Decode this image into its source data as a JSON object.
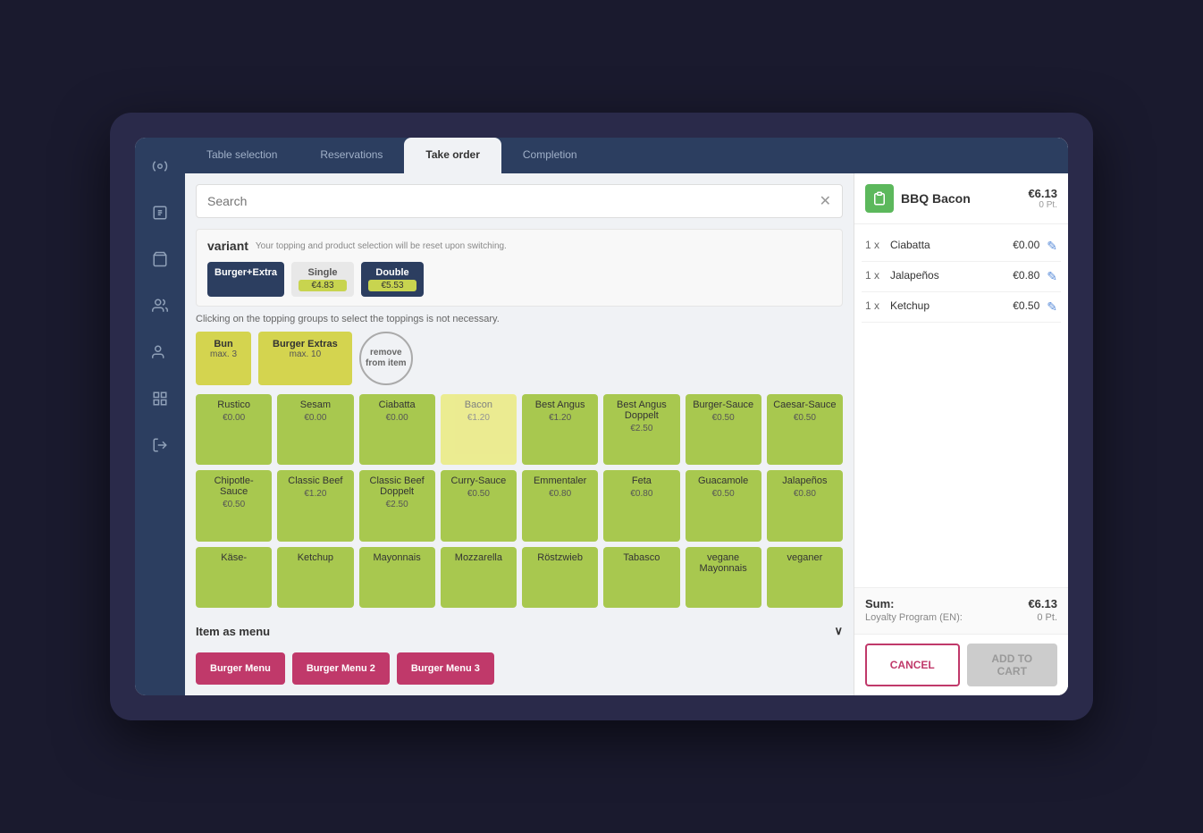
{
  "tabs": [
    {
      "label": "Table selection",
      "active": false
    },
    {
      "label": "Reservations",
      "active": false
    },
    {
      "label": "Take order",
      "active": true
    },
    {
      "label": "Completion",
      "active": false
    }
  ],
  "sidebar": {
    "icons": [
      "nav-icon-1",
      "nav-icon-2",
      "nav-icon-3",
      "nav-icon-4",
      "nav-icon-5",
      "nav-icon-6"
    ]
  },
  "search": {
    "placeholder": "Search"
  },
  "variant": {
    "label": "variant",
    "subtitle": "Your topping and product selection will be reset upon switching.",
    "options": [
      {
        "label": "Burger+Extra",
        "price": null,
        "style": "dark"
      },
      {
        "label": "Single",
        "price": "€4.83",
        "style": "light"
      },
      {
        "label": "Double",
        "price": "€5.53",
        "style": "dark"
      }
    ]
  },
  "topping_info": "Clicking on the topping groups to select the toppings is not necessary.",
  "topping_groups": [
    {
      "label": "Bun",
      "max": "max. 3"
    },
    {
      "label": "Burger Extras",
      "max": "max. 10"
    },
    {
      "label": "remove from item",
      "style": "circle"
    }
  ],
  "toppings": [
    {
      "name": "Rustico",
      "price": "€0.00"
    },
    {
      "name": "Sesam",
      "price": "€0.00"
    },
    {
      "name": "Ciabatta",
      "price": "€0.00",
      "selected": true
    },
    {
      "name": "Bacon",
      "price": "€1.20",
      "light": true
    },
    {
      "name": "Best Angus",
      "price": "€1.20"
    },
    {
      "name": "Best Angus Doppelt",
      "price": "€2.50"
    },
    {
      "name": "Burger-Sauce",
      "price": "€0.50"
    },
    {
      "name": "Caesar-Sauce",
      "price": "€0.50"
    },
    {
      "name": "Chipotle-Sauce",
      "price": "€0.50"
    },
    {
      "name": "Classic Beef",
      "price": "€1.20"
    },
    {
      "name": "Classic Beef Doppelt",
      "price": "€2.50"
    },
    {
      "name": "Curry-Sauce",
      "price": "€0.50"
    },
    {
      "name": "Emmentaler",
      "price": "€0.80"
    },
    {
      "name": "Feta",
      "price": "€0.80"
    },
    {
      "name": "Guacamole",
      "price": "€0.50"
    },
    {
      "name": "Jalapeños",
      "price": "€0.80",
      "selected": true
    },
    {
      "name": "Käse-",
      "price": ""
    },
    {
      "name": "Ketchup",
      "price": ""
    },
    {
      "name": "Mayonnais",
      "price": ""
    },
    {
      "name": "Mozzarella",
      "price": ""
    },
    {
      "name": "Röstzwieb",
      "price": ""
    },
    {
      "name": "Tabasco",
      "price": ""
    },
    {
      "name": "vegane Mayonnais",
      "price": ""
    },
    {
      "name": "veganer",
      "price": ""
    }
  ],
  "menu_section": {
    "label": "Item as menu",
    "buttons": [
      {
        "label": "Burger Menu"
      },
      {
        "label": "Burger Menu 2"
      },
      {
        "label": "Burger Menu 3"
      }
    ]
  },
  "order": {
    "title": "BBQ Bacon",
    "price": "€6.13",
    "pts": "0 Pt.",
    "items": [
      {
        "qty": "1 x",
        "name": "Ciabatta",
        "price": "€0.00"
      },
      {
        "qty": "1 x",
        "name": "Jalapeños",
        "price": "€0.80"
      },
      {
        "qty": "1 x",
        "name": "Ketchup",
        "price": "€0.50"
      }
    ],
    "sum_label": "Sum:",
    "sum_value": "€6.13",
    "loyalty_label": "Loyalty Program (EN):",
    "loyalty_value": "0 Pt."
  },
  "buttons": {
    "cancel": "CANCEL",
    "add_to_cart": "ADD TO CART"
  }
}
